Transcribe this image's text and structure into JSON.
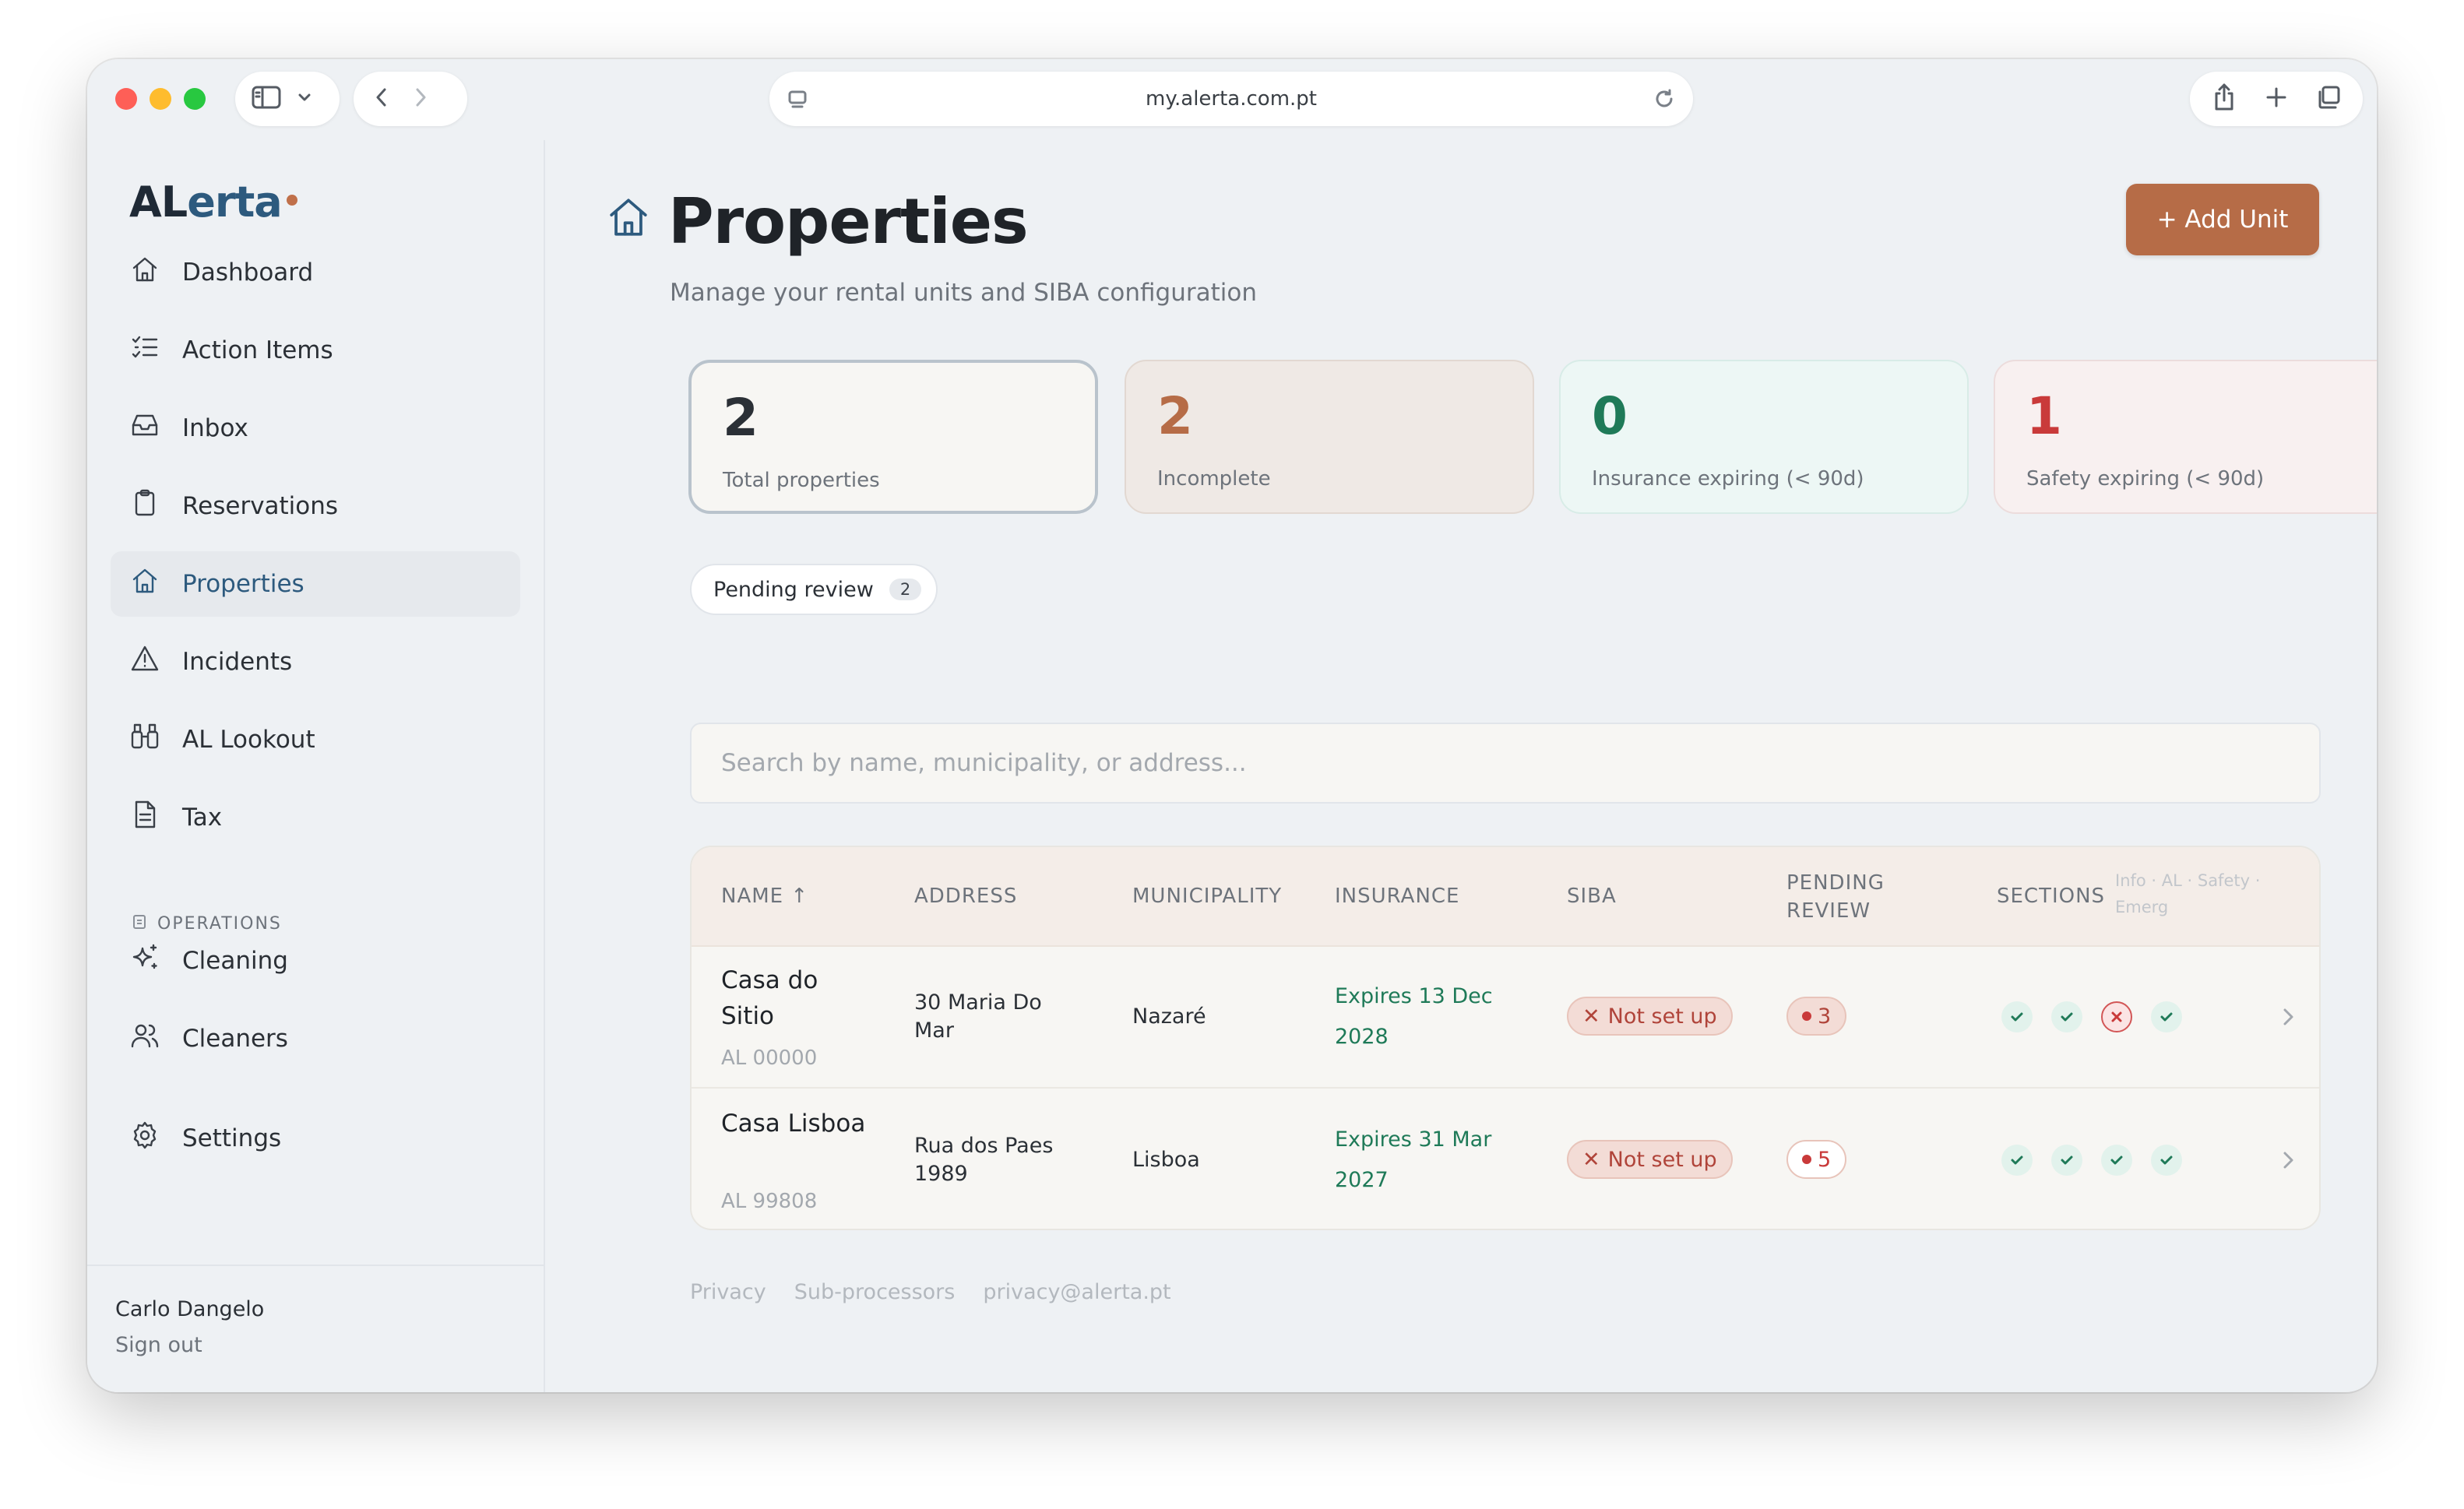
{
  "browser": {
    "url": "my.alerta.com.pt"
  },
  "brand": {
    "logo_part1": "AL",
    "logo_part2": "erta",
    "accent": "#b66c47",
    "primary": "#2d5a7e"
  },
  "sidebar": {
    "items": [
      {
        "label": "Dashboard",
        "icon": "home-icon"
      },
      {
        "label": "Action Items",
        "icon": "checklist-icon"
      },
      {
        "label": "Inbox",
        "icon": "inbox-icon"
      },
      {
        "label": "Reservations",
        "icon": "clipboard-icon"
      },
      {
        "label": "Properties",
        "icon": "home-icon",
        "active": true
      },
      {
        "label": "Incidents",
        "icon": "warning-icon"
      },
      {
        "label": "AL Lookout",
        "icon": "binoculars-icon"
      },
      {
        "label": "Tax",
        "icon": "document-icon"
      }
    ],
    "section_label": "OPERATIONS",
    "ops_items": [
      {
        "label": "Cleaning",
        "icon": "sparkles-icon"
      },
      {
        "label": "Cleaners",
        "icon": "users-icon"
      }
    ],
    "settings_label": "Settings",
    "user_name": "Carlo Dangelo",
    "sign_out": "Sign out"
  },
  "header": {
    "title": "Properties",
    "subtitle": "Manage your rental units and SIBA configuration",
    "add_button": "+ Add Unit"
  },
  "stats": [
    {
      "value": "2",
      "label": "Total properties",
      "color": "#2b3036"
    },
    {
      "value": "2",
      "label": "Incomplete",
      "color": "#b66c47"
    },
    {
      "value": "0",
      "label": "Insurance expiring (< 90d)",
      "color": "#1f7a58"
    },
    {
      "value": "1",
      "label": "Safety expiring (< 90d)",
      "color": "#c93a3a"
    }
  ],
  "filter_chip": {
    "label": "Pending review",
    "count": "2"
  },
  "search": {
    "placeholder": "Search by name, municipality, or address..."
  },
  "table": {
    "columns": {
      "name": "NAME ↑",
      "address": "ADDRESS",
      "municipality": "MUNICIPALITY",
      "insurance": "INSURANCE",
      "siba": "SIBA",
      "pending_review": "PENDING REVIEW",
      "sections": "SECTIONS",
      "sections_hint": "Info · AL · Safety · Emerg"
    },
    "rows": [
      {
        "name": "Casa do Sitio",
        "code": "AL 00000",
        "address": "30 Maria Do Mar",
        "municipality": "Nazaré",
        "insurance": "Expires 13 Dec 2028",
        "siba": "Not set up",
        "pending": "3",
        "sections": [
          "ok",
          "ok",
          "missing",
          "ok"
        ]
      },
      {
        "name": "Casa Lisboa",
        "code": "AL 99808",
        "address": "Rua dos Paes 1989",
        "municipality": "Lisboa",
        "insurance": "Expires 31 Mar 2027",
        "siba": "Not set up",
        "pending": "5",
        "sections": [
          "ok",
          "ok",
          "ok",
          "ok"
        ]
      }
    ]
  },
  "footer": {
    "privacy": "Privacy",
    "subprocessors": "Sub-processors",
    "email": "privacy@alerta.pt"
  }
}
